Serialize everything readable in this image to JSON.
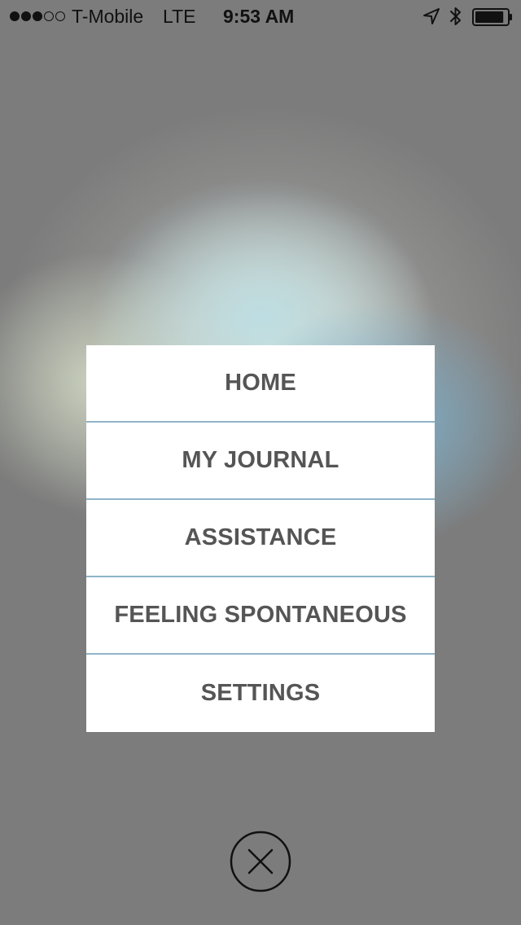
{
  "status_bar": {
    "signal_dots": [
      true,
      true,
      true,
      false,
      false
    ],
    "carrier": "T-Mobile",
    "network": "LTE",
    "time": "9:53 AM",
    "icons": [
      "location-arrow-icon",
      "bluetooth-icon",
      "battery-icon"
    ],
    "battery_level": 0.9
  },
  "menu": {
    "items": [
      {
        "label": "HOME"
      },
      {
        "label": "MY JOURNAL"
      },
      {
        "label": "ASSISTANCE"
      },
      {
        "label": "FEELING SPONTANEOUS"
      },
      {
        "label": "SETTINGS"
      }
    ]
  },
  "close_button": {
    "icon": "close-x-icon"
  },
  "colors": {
    "background": "#7c7c7c",
    "menu_background": "#ffffff",
    "menu_text": "#555555",
    "divider": "#8fb4c9"
  }
}
